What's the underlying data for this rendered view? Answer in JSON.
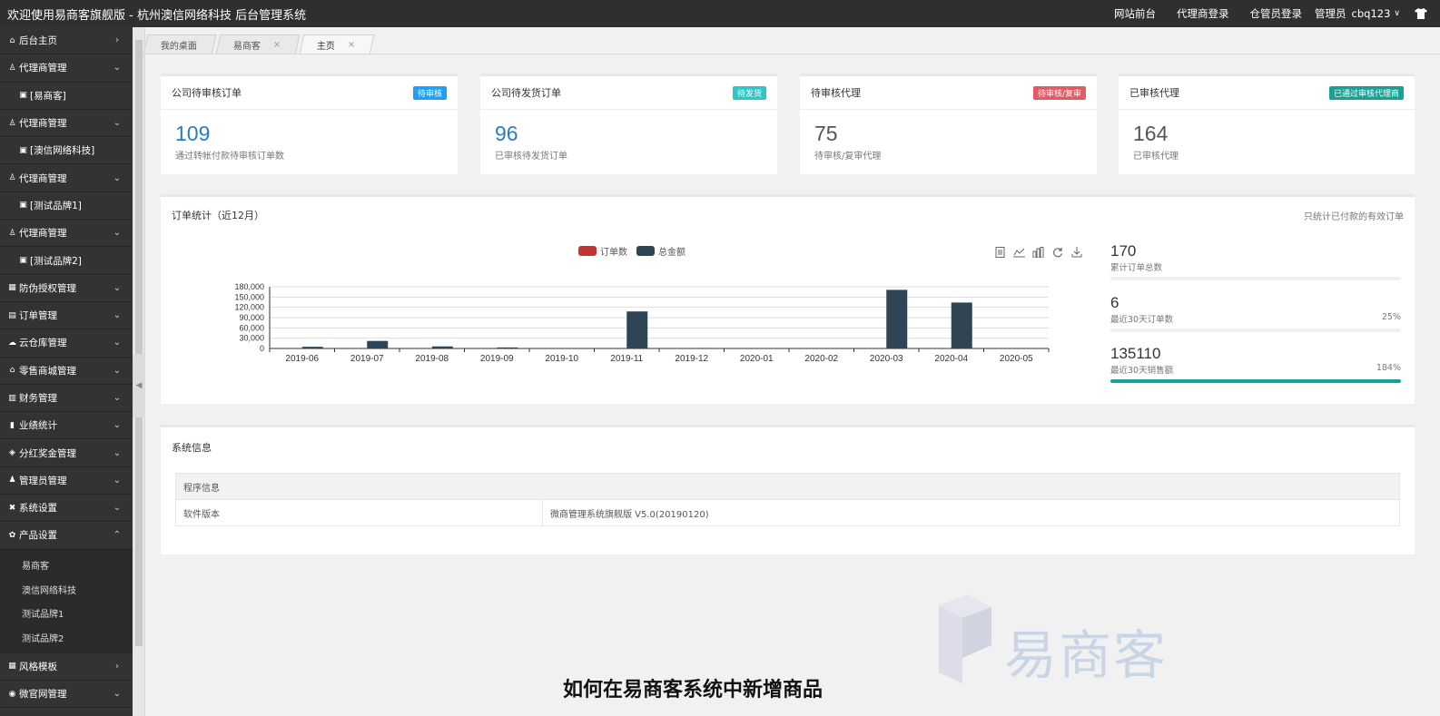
{
  "topbar": {
    "title": "欢迎使用易商客旗舰版 - 杭州澳信网络科技 后台管理系统",
    "links": [
      "网站前台",
      "代理商登录",
      "仓管员登录"
    ],
    "admin_label": "管理员",
    "username": "cbq123"
  },
  "sidebar": {
    "items": [
      {
        "icon": "home-icon",
        "label": "后台主页",
        "arrow": "›",
        "type": "item"
      },
      {
        "icon": "user-icon",
        "label": "代理商管理",
        "arrow": "⌄",
        "type": "item"
      },
      {
        "icon": "lock-icon",
        "label": "[易商客]",
        "arrow": "",
        "type": "sub"
      },
      {
        "icon": "user-icon",
        "label": "代理商管理",
        "arrow": "⌄",
        "type": "item"
      },
      {
        "icon": "lock-icon",
        "label": "[澳信网络科技]",
        "arrow": "",
        "type": "sub"
      },
      {
        "icon": "user-icon",
        "label": "代理商管理",
        "arrow": "⌄",
        "type": "item"
      },
      {
        "icon": "lock-icon",
        "label": "[测试品牌1]",
        "arrow": "",
        "type": "sub"
      },
      {
        "icon": "user-icon",
        "label": "代理商管理",
        "arrow": "⌄",
        "type": "item"
      },
      {
        "icon": "lock-icon",
        "label": "[测试品牌2]",
        "arrow": "",
        "type": "sub"
      },
      {
        "icon": "table-icon",
        "label": "防伪授权管理",
        "arrow": "⌄",
        "type": "item"
      },
      {
        "icon": "document-icon",
        "label": "订单管理",
        "arrow": "⌄",
        "type": "item"
      },
      {
        "icon": "cloud-icon",
        "label": "云仓库管理",
        "arrow": "⌄",
        "type": "item"
      },
      {
        "icon": "store-icon",
        "label": "零售商城管理",
        "arrow": "⌄",
        "type": "item"
      },
      {
        "icon": "finance-icon",
        "label": "财务管理",
        "arrow": "⌄",
        "type": "item"
      },
      {
        "icon": "chart-icon",
        "label": "业绩统计",
        "arrow": "⌄",
        "type": "item"
      },
      {
        "icon": "gift-icon",
        "label": "分红奖金管理",
        "arrow": "⌄",
        "type": "item"
      },
      {
        "icon": "admin-icon",
        "label": "管理员管理",
        "arrow": "⌄",
        "type": "item"
      },
      {
        "icon": "wrench-icon",
        "label": "系统设置",
        "arrow": "⌄",
        "type": "item"
      },
      {
        "icon": "gear-icon",
        "label": "产品设置",
        "arrow": "⌃",
        "type": "item"
      }
    ],
    "children": [
      "易商客",
      "澳信网络科技",
      "测试品牌1",
      "测试品牌2"
    ],
    "after": [
      {
        "icon": "template-icon",
        "label": "风格模板",
        "arrow": "›",
        "type": "item"
      },
      {
        "icon": "web-icon",
        "label": "微官网管理",
        "arrow": "⌄",
        "type": "item"
      }
    ]
  },
  "tabs": [
    {
      "label": "我的桌面",
      "close": ""
    },
    {
      "label": "易商客",
      "close": "×"
    },
    {
      "label": "主页",
      "close": "×"
    }
  ],
  "cards": [
    {
      "title": "公司待审核订单",
      "badge": "待审核",
      "badge_color": "#1e9fff",
      "value": "109",
      "value_color": "#2d7bbd",
      "desc": "通过转帐付款待审核订单数"
    },
    {
      "title": "公司待发货订单",
      "badge": "待发货",
      "badge_color": "#2ec7c9",
      "value": "96",
      "value_color": "#2d7bbd",
      "desc": "已审核待发货订单"
    },
    {
      "title": "待审核代理",
      "badge": "待审核/复审",
      "badge_color": "#e15b64",
      "value": "75",
      "value_color": "#555555",
      "desc": "待审核/复审代理"
    },
    {
      "title": "已审核代理",
      "badge": "已通过审核代理商",
      "badge_color": "#1aa094",
      "value": "164",
      "value_color": "#555555",
      "desc": "已审核代理"
    }
  ],
  "order_panel": {
    "title": "订单统计（近12月）",
    "note": "只统计已付款的有效订单"
  },
  "chart_data": {
    "type": "bar",
    "categories": [
      "2019-06",
      "2019-07",
      "2019-08",
      "2019-09",
      "2019-10",
      "2019-11",
      "2019-12",
      "2020-01",
      "2020-02",
      "2020-03",
      "2020-04",
      "2020-05"
    ],
    "series": [
      {
        "name": "订单数",
        "color": "#c23531",
        "values": [
          0,
          0,
          0,
          0,
          0,
          0,
          0,
          0,
          0,
          0,
          0,
          0
        ]
      },
      {
        "name": "总金额",
        "color": "#2f4554",
        "values": [
          5000,
          22000,
          6000,
          3000,
          0,
          108000,
          1500,
          0,
          0,
          171000,
          134000,
          0
        ]
      }
    ],
    "y_ticks": [
      "0",
      "30,000",
      "60,000",
      "90,000",
      "120,000",
      "150,000",
      "180,000"
    ],
    "ylim": [
      0,
      180000
    ],
    "grid": true,
    "legend": "top-center"
  },
  "kpis": [
    {
      "value": "170",
      "label": "累计订单总数",
      "pct": "",
      "fill": 0
    },
    {
      "value": "6",
      "label": "最近30天订单数",
      "pct": "25%",
      "fill": 0
    },
    {
      "value": "135110",
      "label": "最近30天销售额",
      "pct": "184%",
      "fill": 1
    }
  ],
  "sys_panel": {
    "title": "系统信息",
    "table_header": "程序信息",
    "row_key": "软件版本",
    "row_value": "微商管理系统旗舰版 V5.0(20190120)"
  },
  "watermark": "易商客",
  "caption": "如何在易商客系统中新增商品"
}
